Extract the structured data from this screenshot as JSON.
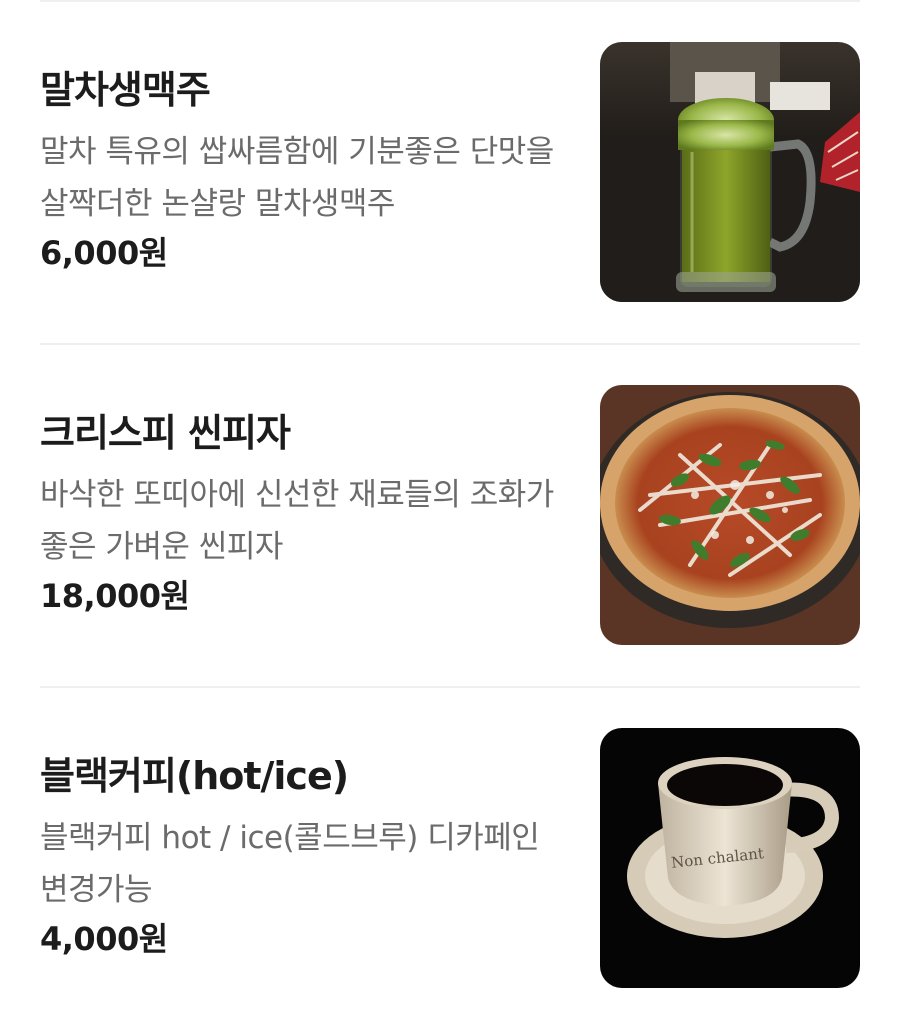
{
  "menu": {
    "items": [
      {
        "name": "말차생맥주",
        "description": "말차 특유의 쌉싸름함에 기분좋은 단맛을 살짝더한 논샬랑 말차생맥주",
        "price": "6,000원",
        "image_icon": "matcha-beer-photo"
      },
      {
        "name": "크리스피 씬피자",
        "description": "바삭한 또띠아에 신선한 재료들의 조화가 좋은 가벼운 씬피자",
        "price": "18,000원",
        "image_icon": "thin-pizza-photo"
      },
      {
        "name": "블랙커피(hot/ice)",
        "description": "블랙커피 hot / ice(콜드브루) 디카페인 변경가능",
        "price": "4,000원",
        "image_icon": "black-coffee-photo",
        "cup_print": "Non chalant"
      }
    ]
  }
}
